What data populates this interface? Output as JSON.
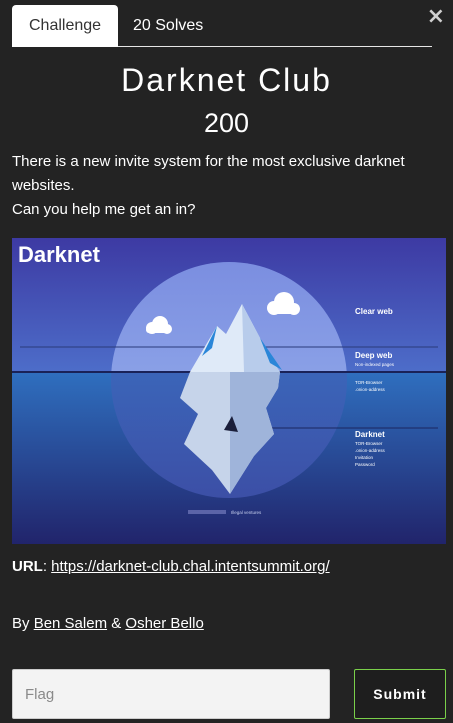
{
  "modal": {
    "close_glyph": "×",
    "tabs": [
      {
        "label": "Challenge",
        "active": true
      },
      {
        "label": "20 Solves",
        "active": false
      }
    ],
    "title": "Darknet Club",
    "points": "200",
    "description": [
      "There is a new invite system for the most exclusive darknet websites.",
      "Can you help me get an in?"
    ],
    "image": {
      "heading": "Darknet",
      "labels": {
        "clear_web": "Clear web",
        "deep_web": "Deep web",
        "deep_web_sub": "Non-indexed pages",
        "tor1": "TOR-Browser",
        "tor1_sub": ".onion-address",
        "darknet": "Darknet",
        "dark_sub1": "TOR-Browser",
        "dark_sub2": ".onion-address",
        "dark_sub3": "Invitation",
        "dark_sub4": "Password",
        "bottom": "Illegal ventures"
      }
    },
    "url_label": "URL",
    "url": "https://darknet-club.chal.intentsummit.org/",
    "by_label": "By",
    "authors": [
      "Ben Salem",
      "Osher Bello"
    ],
    "author_sep": "&",
    "flag_placeholder": "Flag",
    "submit_label": "Submit"
  },
  "colors": {
    "background": "#232323",
    "submit_border": "#7ad04a"
  }
}
